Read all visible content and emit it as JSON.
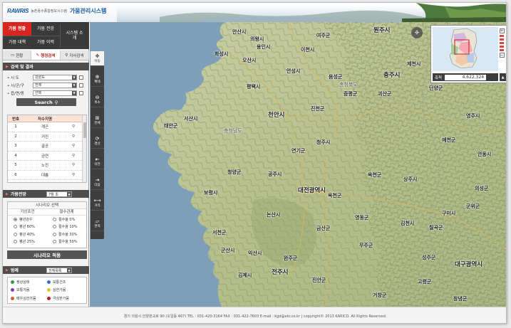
{
  "header": {
    "logo_mark": "RAWRIS",
    "logo_sub": "농촌용수종합정보시스템",
    "title": "가뭄관리시스템"
  },
  "topnav": {
    "items": [
      "가뭄 현황",
      "가뭄 전망",
      "시스템 소개",
      "가뭄 대책",
      "가뭄 이력"
    ]
  },
  "subtabs": [
    "현황",
    "행정검색",
    "지사검색"
  ],
  "search": {
    "section_title": "검색 및 결과",
    "fields": [
      {
        "label": "시  도",
        "value": "강원도"
      },
      {
        "label": "시/군/구",
        "value": "전체"
      },
      {
        "label": "읍/면/동",
        "value": "선택"
      }
    ],
    "button": "Search"
  },
  "results": {
    "headers": [
      "번호",
      "저수지명",
      ""
    ],
    "rows": [
      {
        "no": "1",
        "name": "계곤"
      },
      {
        "no": "2",
        "name": "거진"
      },
      {
        "no": "3",
        "name": "골공"
      },
      {
        "no": "4",
        "name": "금연"
      },
      {
        "no": "5",
        "name": "노진"
      },
      {
        "no": "6",
        "name": "대룡"
      }
    ]
  },
  "forecast": {
    "section_title": "가뭄전망",
    "month": "7월 초",
    "scenario_title": "시나리오 선택",
    "col_weather": "기상조건",
    "col_water": "절수관계",
    "weather_options": [
      "평년강우",
      "평년 60%",
      "평년 40%",
      "평년 25%"
    ],
    "water_options": [
      "절수율 0%",
      "절수율 10%",
      "절수율 30%",
      "절수율 50%"
    ],
    "apply": "시나리오 적용"
  },
  "legend": {
    "section_title": "범례",
    "select": "전체목록",
    "items": [
      {
        "label": "정상상태",
        "color": "#2e9e3a"
      },
      {
        "label": "보통건조",
        "color": "#2f6fd6"
      },
      {
        "label": "보통가뭄",
        "color": "#7a3fb8"
      },
      {
        "label": "심한가뭄",
        "color": "#e9c21a"
      },
      {
        "label": "매우심한가뭄",
        "color": "#e4572e"
      },
      {
        "label": "극심한가뭄",
        "color": "#c8102e"
      }
    ]
  },
  "toolbar": {
    "items": [
      "이동",
      "확대",
      "축소",
      "전체",
      "경선",
      "이전",
      "다음",
      "거리",
      "면적"
    ]
  },
  "map": {
    "cities": [
      {
        "name": "안산시",
        "cls": ""
      },
      {
        "name": "여주군",
        "cls": ""
      },
      {
        "name": "원주시",
        "cls": "big"
      },
      {
        "name": "의왕시",
        "cls": ""
      },
      {
        "name": "용인시",
        "cls": ""
      },
      {
        "name": "이천시",
        "cls": ""
      },
      {
        "name": "화성시",
        "cls": ""
      },
      {
        "name": "오산시",
        "cls": ""
      },
      {
        "name": "평택시",
        "cls": ""
      },
      {
        "name": "안성시",
        "cls": ""
      },
      {
        "name": "충주시",
        "cls": "big"
      },
      {
        "name": "음성군",
        "cls": ""
      },
      {
        "name": "충청북도",
        "cls": "faint"
      },
      {
        "name": "제천시",
        "cls": ""
      },
      {
        "name": "단양군",
        "cls": ""
      },
      {
        "name": "증평군",
        "cls": ""
      },
      {
        "name": "괴산군",
        "cls": ""
      },
      {
        "name": "서산시",
        "cls": ""
      },
      {
        "name": "천안시",
        "cls": "big"
      },
      {
        "name": "진천군",
        "cls": ""
      },
      {
        "name": "영주시",
        "cls": ""
      },
      {
        "name": "태안군",
        "cls": ""
      },
      {
        "name": "충청남도",
        "cls": "faint"
      },
      {
        "name": "청주시",
        "cls": ""
      },
      {
        "name": "예천군",
        "cls": ""
      },
      {
        "name": "연기군",
        "cls": ""
      },
      {
        "name": "안동시",
        "cls": ""
      },
      {
        "name": "청양군",
        "cls": ""
      },
      {
        "name": "공주시",
        "cls": ""
      },
      {
        "name": "옥천군",
        "cls": ""
      },
      {
        "name": "상주시",
        "cls": ""
      },
      {
        "name": "대전광역시",
        "cls": "big"
      },
      {
        "name": "의성군",
        "cls": ""
      },
      {
        "name": "보령시",
        "cls": ""
      },
      {
        "name": "옥천군",
        "cls": ""
      },
      {
        "name": "군위군",
        "cls": ""
      },
      {
        "name": "논산시",
        "cls": ""
      },
      {
        "name": "영동군",
        "cls": ""
      },
      {
        "name": "구미시",
        "cls": ""
      },
      {
        "name": "서천군",
        "cls": ""
      },
      {
        "name": "금산군",
        "cls": ""
      },
      {
        "name": "김천시",
        "cls": ""
      },
      {
        "name": "칠곡군",
        "cls": ""
      },
      {
        "name": "군산시",
        "cls": ""
      },
      {
        "name": "익산시",
        "cls": ""
      },
      {
        "name": "무주군",
        "cls": ""
      },
      {
        "name": "성주군",
        "cls": ""
      },
      {
        "name": "완주군",
        "cls": ""
      },
      {
        "name": "대구광역시",
        "cls": "big"
      },
      {
        "name": "김제시",
        "cls": ""
      },
      {
        "name": "전주시",
        "cls": "big"
      },
      {
        "name": "진안군",
        "cls": ""
      },
      {
        "name": "고령군",
        "cls": ""
      },
      {
        "name": "거창군",
        "cls": ""
      },
      {
        "name": "창녕군",
        "cls": ""
      }
    ],
    "scale_label": "축척",
    "scale_value": "4,622,324"
  },
  "footer": {
    "text": "경기 의왕시 안양판교로 90 (오일동 467)  TEL : 031-420-3164    FAX : 031-422-7603    E-mail : kgd@ekr.co.kr    |    copyright© 2013 KARICO. All Rights Reserved."
  }
}
